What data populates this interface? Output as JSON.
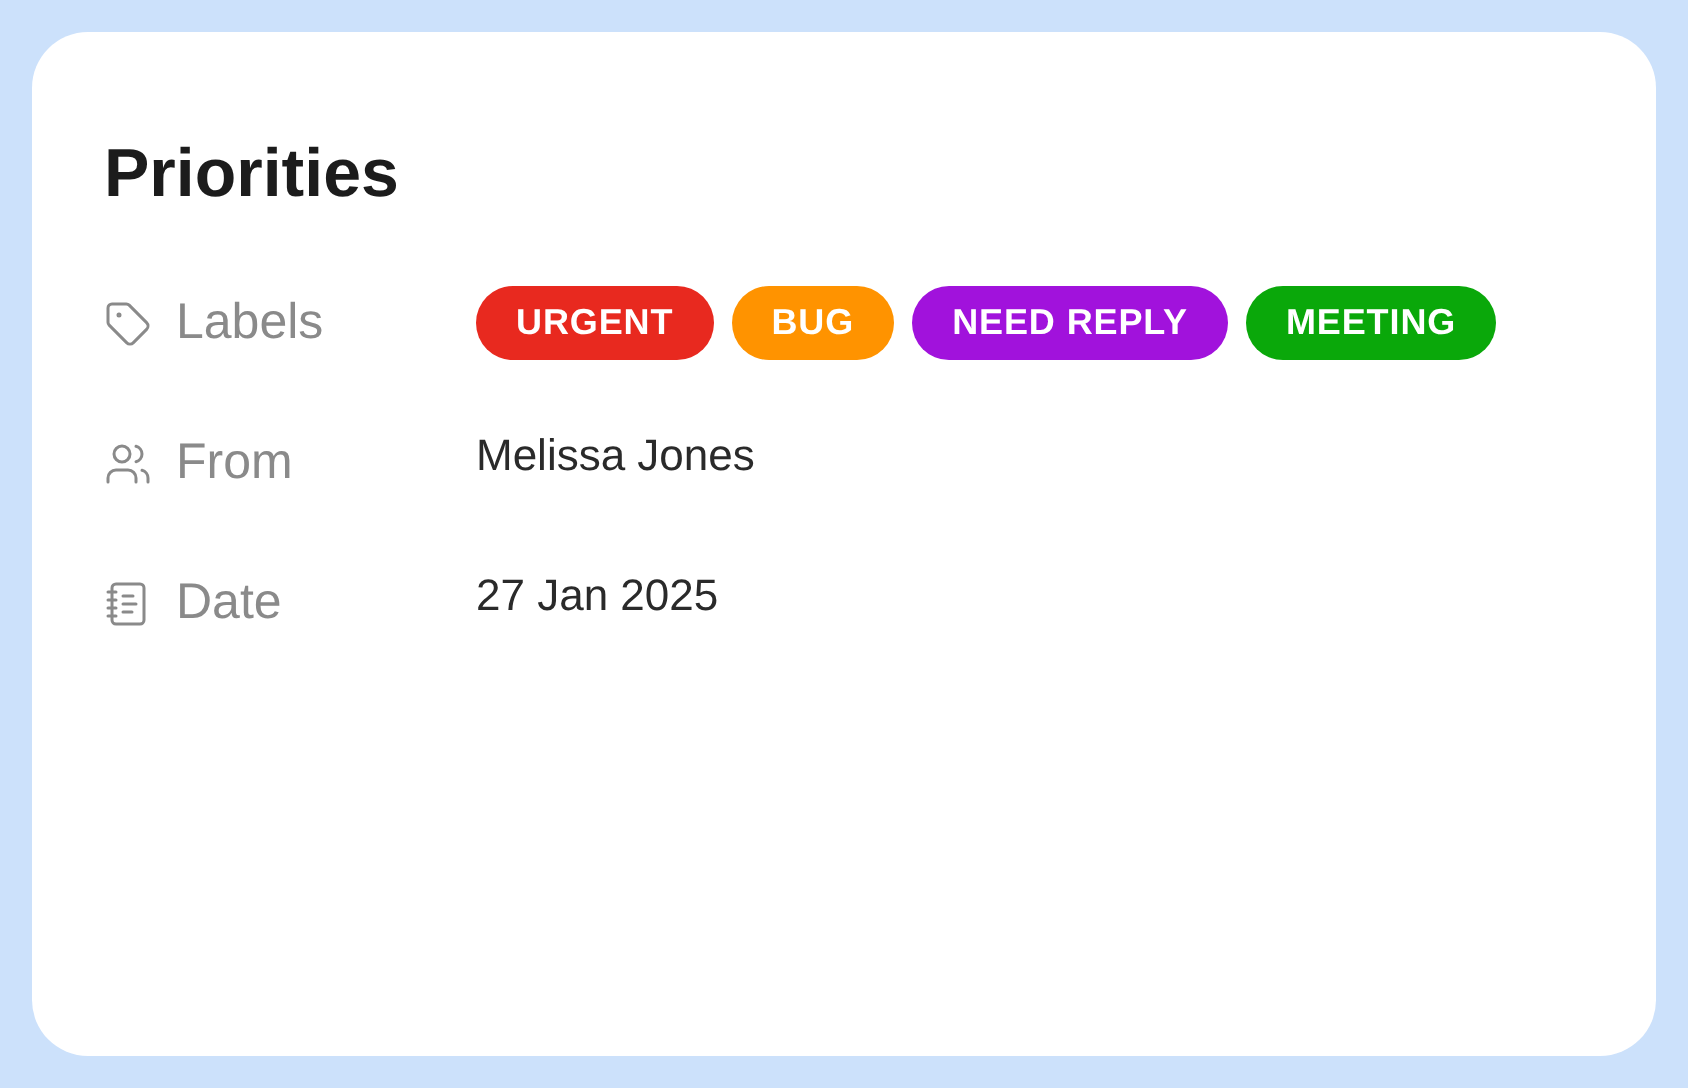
{
  "title": "Priorities",
  "fields": [
    {
      "kind": "tags",
      "label": "Labels",
      "tags": [
        {
          "text": "URGENT",
          "color": "#e8291f"
        },
        {
          "text": "BUG",
          "color": "#ff9300"
        },
        {
          "text": "NEED REPLY",
          "color": "#a112dc"
        },
        {
          "text": "MEETING",
          "color": "#0aa80a"
        }
      ]
    },
    {
      "kind": "person",
      "label": "From",
      "value": "Melissa Jones"
    },
    {
      "kind": "date",
      "label": "Date",
      "value": "27 Jan 2025"
    }
  ]
}
